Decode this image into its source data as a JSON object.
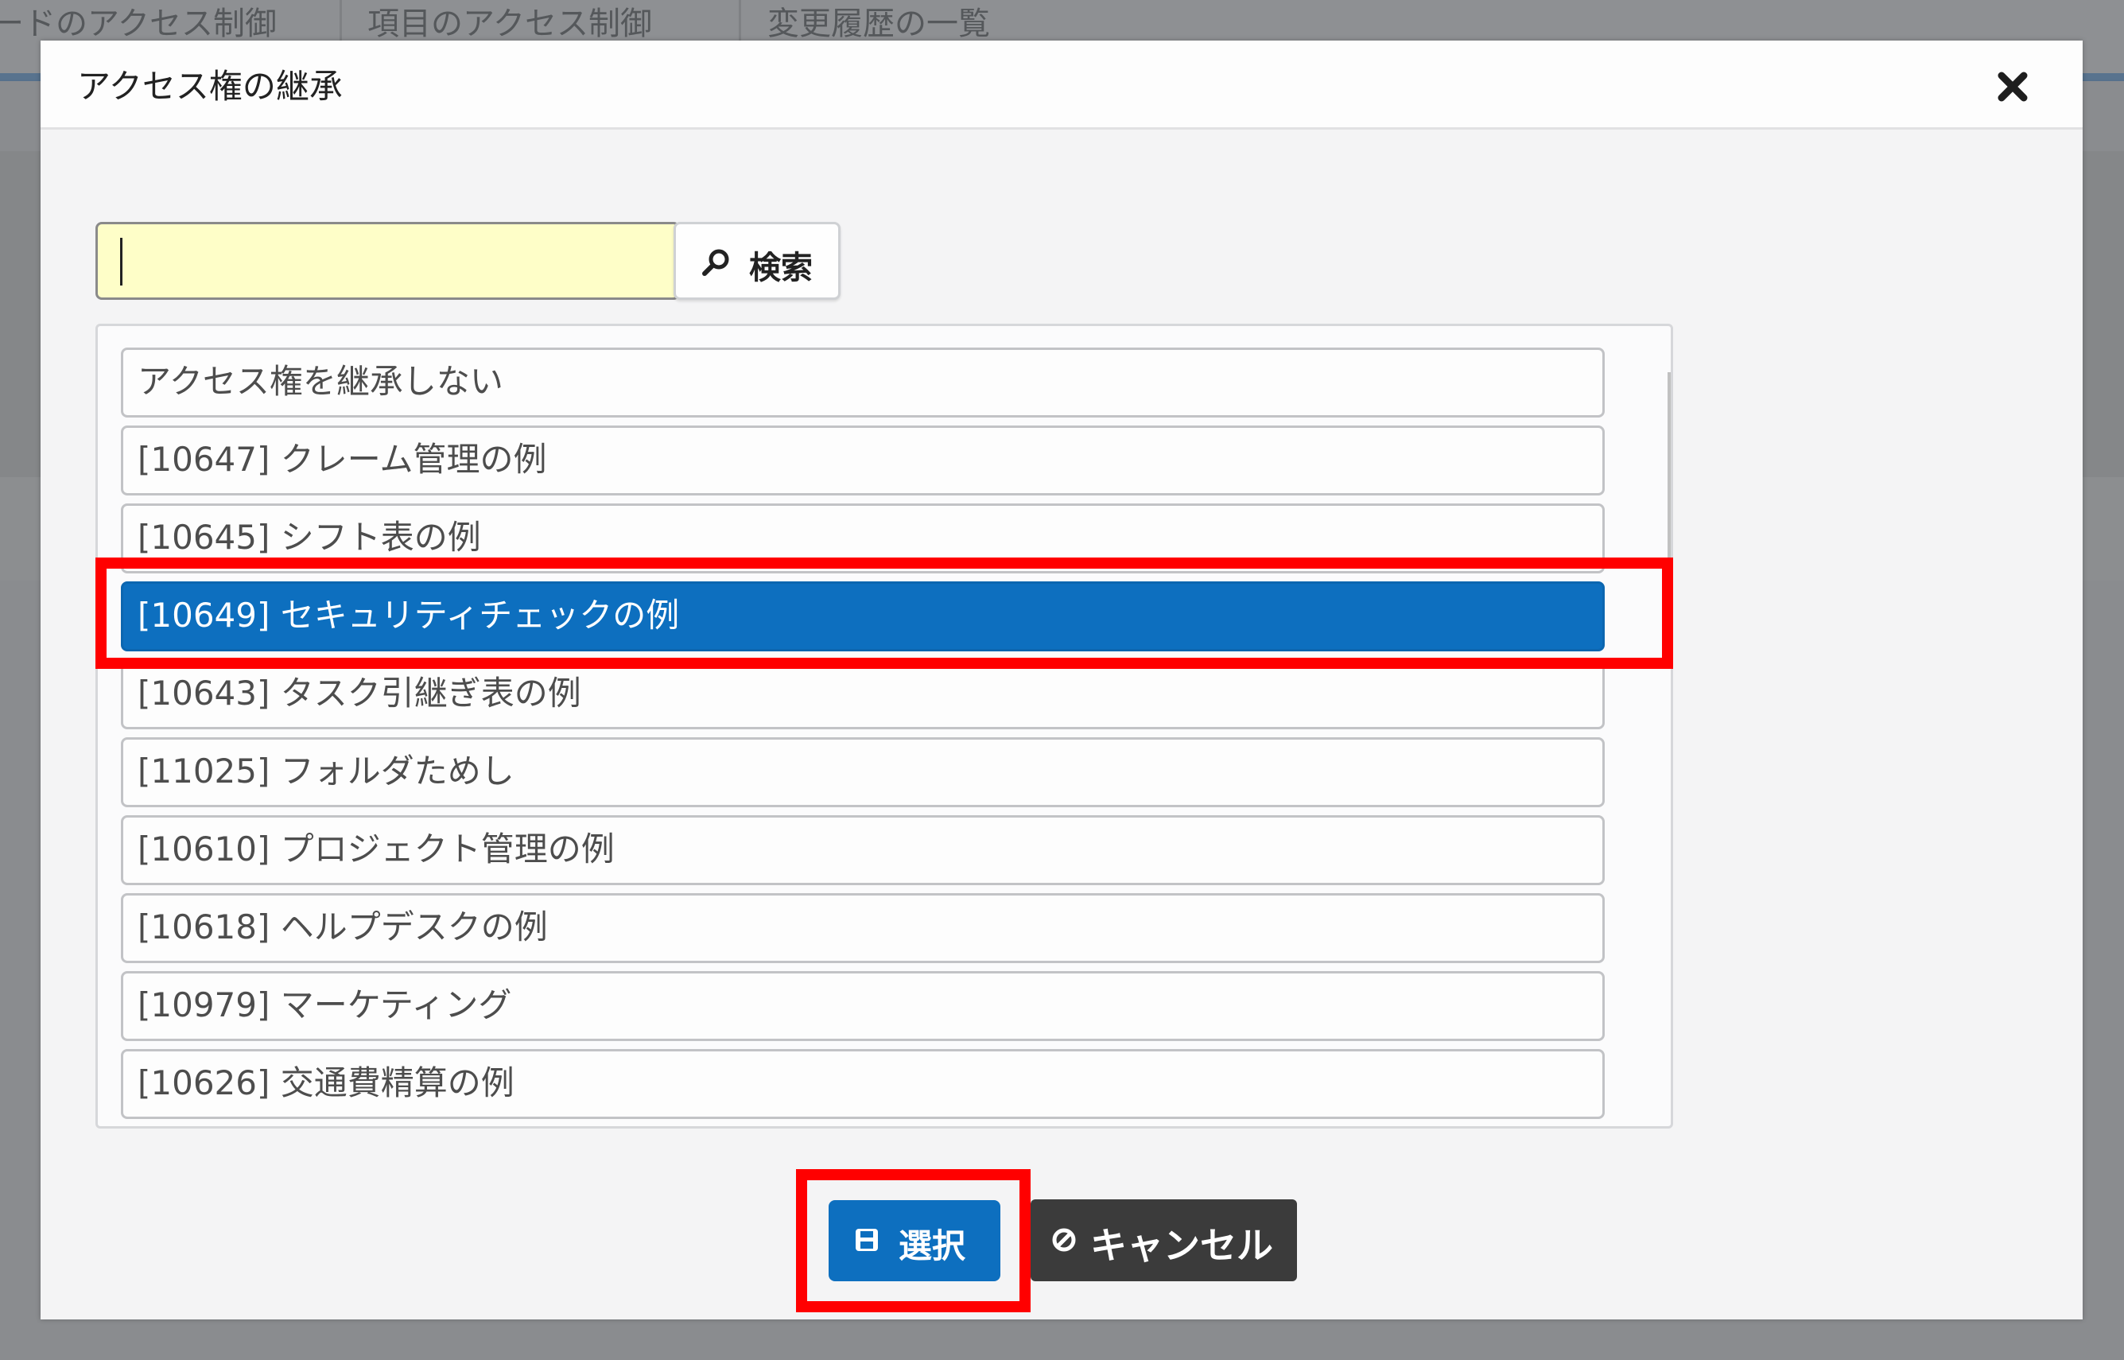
{
  "background": {
    "tabs": [
      {
        "label": "ードのアクセス制御"
      },
      {
        "label": "項目のアクセス制御"
      },
      {
        "label": "変更履歴の一覧"
      }
    ]
  },
  "dialog": {
    "title": "アクセス権の継承",
    "close_icon": "close-icon",
    "search": {
      "value": "",
      "placeholder": "",
      "button_label": "検索",
      "button_icon": "search-icon"
    },
    "items": [
      {
        "label": "アクセス権を継承しない",
        "selected": false
      },
      {
        "label": "[10647] クレーム管理の例",
        "selected": false
      },
      {
        "label": "[10645] シフト表の例",
        "selected": false
      },
      {
        "label": "[10649] セキュリティチェックの例",
        "selected": true
      },
      {
        "label": "[10643] タスク引継ぎ表の例",
        "selected": false
      },
      {
        "label": "[11025] フォルダためし",
        "selected": false
      },
      {
        "label": "[10610] プロジェクト管理の例",
        "selected": false
      },
      {
        "label": "[10618] ヘルプデスクの例",
        "selected": false
      },
      {
        "label": "[10979] マーケティング",
        "selected": false
      },
      {
        "label": "[10626] 交通費精算の例",
        "selected": false
      }
    ],
    "buttons": {
      "select_label": "選択",
      "select_icon": "save-icon",
      "cancel_label": "キャンセル",
      "cancel_icon": "ban-icon"
    }
  },
  "colors": {
    "selected_bg": "#0d6fbf",
    "highlight": "#ff0000",
    "input_bg": "#fefec8",
    "cancel_bg": "#3b3b3b"
  }
}
